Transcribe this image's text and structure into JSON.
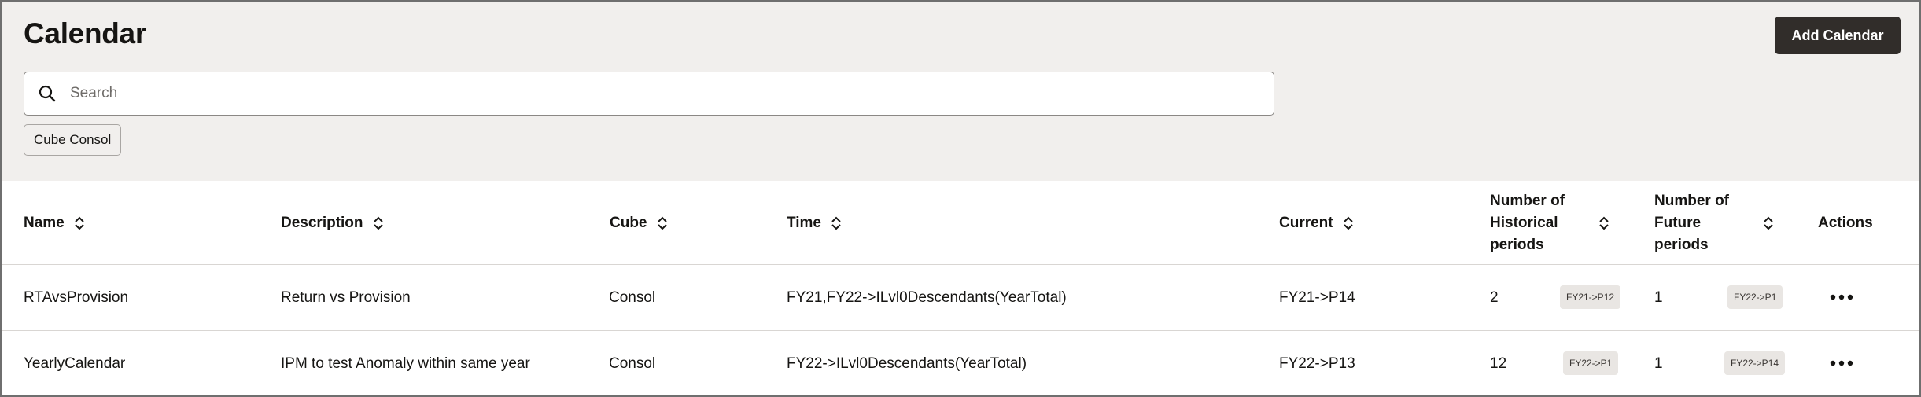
{
  "page": {
    "title": "Calendar",
    "add_button_label": "Add Calendar"
  },
  "search": {
    "placeholder": "Search",
    "value": "",
    "icon": "search-icon"
  },
  "filter_chip": {
    "label": "Cube Consol"
  },
  "table": {
    "columns": {
      "name": "Name",
      "description": "Description",
      "cube": "Cube",
      "time": "Time",
      "current": "Current",
      "historical": "Number of Historical periods",
      "future": "Number of Future periods",
      "actions": "Actions"
    },
    "rows": [
      {
        "name": "RTAvsProvision",
        "description": "Return vs Provision",
        "cube": "Consol",
        "time": "FY21,FY22->ILvl0Descendants(YearTotal)",
        "current": "FY21->P14",
        "historical": "2",
        "historical_badge": "FY21->P12",
        "future": "1",
        "future_badge": "FY22->P1"
      },
      {
        "name": "YearlyCalendar",
        "description": "IPM to test Anomaly within same year",
        "cube": "Consol",
        "time": "FY22->ILvl0Descendants(YearTotal)",
        "current": "FY22->P13",
        "historical": "12",
        "historical_badge": "FY22->P1",
        "future": "1",
        "future_badge": "FY22->P14"
      }
    ]
  },
  "colors": {
    "header_background": "#f1efed",
    "primary_button": "#312d2a",
    "text": "#161513",
    "badge_background": "#e9e6e3"
  }
}
